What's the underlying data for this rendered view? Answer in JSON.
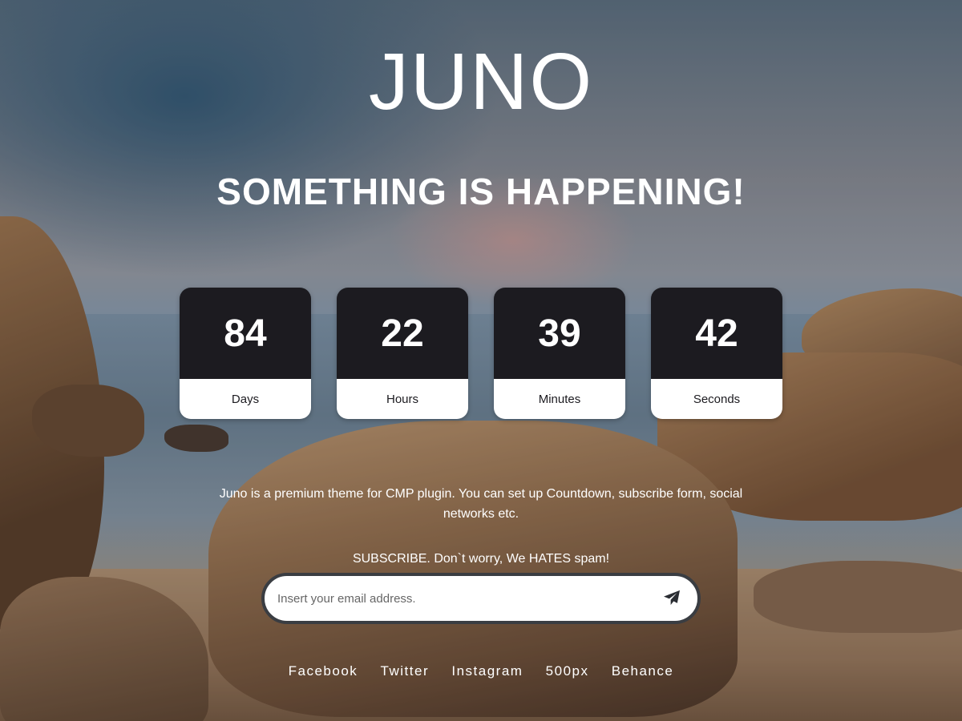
{
  "brand": {
    "logo_text": "JUNO"
  },
  "headline": "SOMETHING IS HAPPENING!",
  "countdown": [
    {
      "value": "84",
      "label": "Days"
    },
    {
      "value": "22",
      "label": "Hours"
    },
    {
      "value": "39",
      "label": "Minutes"
    },
    {
      "value": "42",
      "label": "Seconds"
    }
  ],
  "description": "Juno is a premium theme for CMP plugin. You can set up Countdown, subscribe form, social networks etc.",
  "subscribe": {
    "label": "SUBSCRIBE. Don`t worry, We HATES spam!",
    "placeholder": "Insert your email address.",
    "send_icon": "paper-plane-icon"
  },
  "social": [
    "Facebook",
    "Twitter",
    "Instagram",
    "500px",
    "Behance"
  ],
  "colors": {
    "box_dark": "#1c1b20",
    "box_light": "#ffffff",
    "form_border": "#3a3d42"
  }
}
